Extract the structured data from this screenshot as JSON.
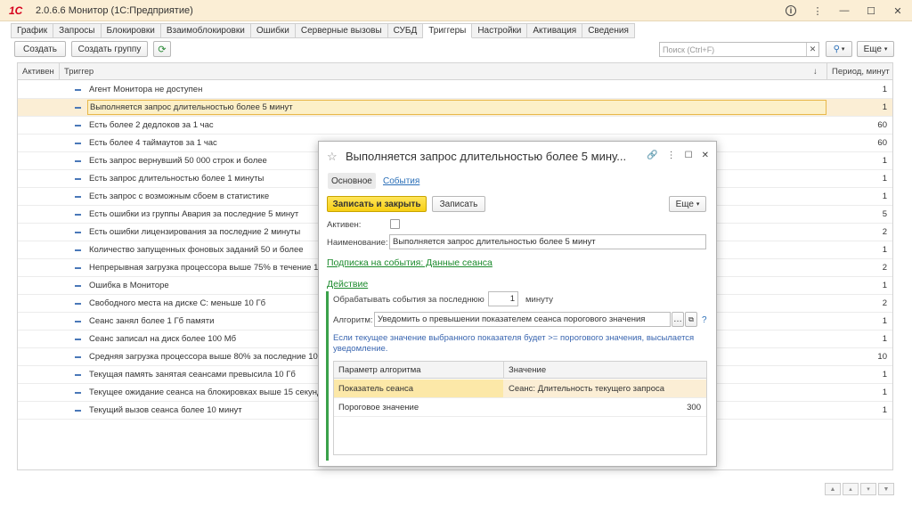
{
  "window": {
    "logo": "1С",
    "title": "2.0.6.6  Монитор  (1С:Предприятие)"
  },
  "tabs": [
    {
      "label": "График"
    },
    {
      "label": "Запросы"
    },
    {
      "label": "Блокировки"
    },
    {
      "label": "Взаимоблокировки"
    },
    {
      "label": "Ошибки"
    },
    {
      "label": "Серверные вызовы"
    },
    {
      "label": "СУБД"
    },
    {
      "label": "Триггеры"
    },
    {
      "label": "Настройки"
    },
    {
      "label": "Активация"
    },
    {
      "label": "Сведения"
    }
  ],
  "toolbar": {
    "create": "Создать",
    "create_group": "Создать группу",
    "search_placeholder": "Поиск (Ctrl+F)",
    "more": "Еще"
  },
  "table": {
    "headers": {
      "active": "Активен",
      "trigger": "Триггер",
      "period": "Период, минут"
    },
    "rows": [
      {
        "name": "Агент Монитора не доступен",
        "period": "1"
      },
      {
        "name": "Выполняется запрос длительностью более 5 минут",
        "period": "1"
      },
      {
        "name": "Есть более 2 дедлоков за 1 час",
        "period": "60"
      },
      {
        "name": "Есть более 4 таймаутов за 1 час",
        "period": "60"
      },
      {
        "name": "Есть запрос вернувший 50 000 строк и более",
        "period": "1"
      },
      {
        "name": "Есть запрос длительностью более 1 минуты",
        "period": "1"
      },
      {
        "name": "Есть запрос с возможным сбоем в статистике",
        "period": "1"
      },
      {
        "name": "Есть ошибки из группы Авария за последние 5 минут",
        "period": "5"
      },
      {
        "name": "Есть ошибки лицензирования за последние 2 минуты",
        "period": "2"
      },
      {
        "name": "Количество запущенных фоновых заданий 50 и более",
        "period": "1"
      },
      {
        "name": "Непрерывная загрузка процессора выше 75% в течение 1",
        "period": "2"
      },
      {
        "name": "Ошибка в Мониторе",
        "period": "1"
      },
      {
        "name": "Свободного места на диске С: меньше 10 Гб",
        "period": "2"
      },
      {
        "name": "Сеанс занял более 1 Гб памяти",
        "period": "1"
      },
      {
        "name": "Сеанс записал на диск более 100 Мб",
        "period": "1"
      },
      {
        "name": "Средняя загрузка процессора выше 80% за последние 10",
        "period": "10"
      },
      {
        "name": "Текущая память занятая сеансами превысила 10 Гб",
        "period": "1"
      },
      {
        "name": "Текущее ожидание сеанса на блокировках выше 15 секунд",
        "period": "1"
      },
      {
        "name": "Текущий вызов сеанса более 10 минут",
        "period": "1"
      }
    ]
  },
  "dialog": {
    "title": "Выполняется запрос длительностью более 5 мину...",
    "tab_main": "Основное",
    "tab_events": "События",
    "save_close": "Записать и закрыть",
    "save": "Записать",
    "more": "Еще",
    "active_label": "Активен:",
    "name_label": "Наименование:",
    "name_value": "Выполняется запрос длительностью более 5 минут",
    "subscription_link": "Подписка на события: Данные сеанса",
    "action_link": "Действие",
    "process_label": "Обрабатывать события за последнюю",
    "process_value": "1",
    "process_unit": "минуту",
    "algorithm_label": "Алгоритм:",
    "algorithm_value": "Уведомить о превышении показателем сеанса порогового значения",
    "help": "?",
    "hint": "Если текущее значение выбранного показателя будет >= порогового значения, высылается уведомление.",
    "params_headers": {
      "param": "Параметр алгоритма",
      "value": "Значение"
    },
    "params": [
      {
        "param": "Показатель сеанса",
        "value": "Сеанс: Длительность текущего запроса"
      },
      {
        "param": "Пороговое значение",
        "value": "300"
      }
    ]
  }
}
